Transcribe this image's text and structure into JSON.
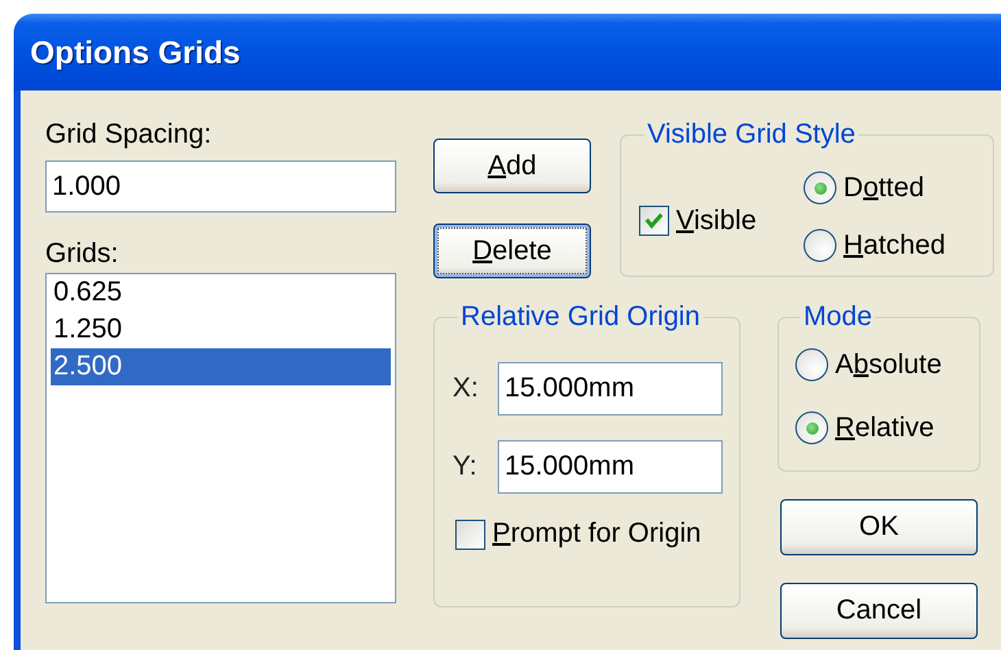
{
  "window": {
    "title": "Options Grids"
  },
  "grid_spacing": {
    "label": "Grid Spacing:",
    "value": "1.000"
  },
  "grids": {
    "label": "Grids:",
    "items": [
      {
        "text": "0.625",
        "selected": false
      },
      {
        "text": "1.250",
        "selected": false
      },
      {
        "text": "2.500",
        "selected": true
      }
    ]
  },
  "buttons": [
    {
      "label": [
        {
          "text": "A",
          "underlined": true
        },
        {
          "text": "dd",
          "underlined": false
        }
      ],
      "focused": false
    },
    {
      "label": [
        {
          "text": "D",
          "underlined": true
        },
        {
          "text": "elete",
          "underlined": false
        }
      ],
      "focused": true
    }
  ],
  "visible_grid_style": {
    "title": "Visible Grid Style",
    "visible": {
      "label": [
        {
          "text": "V",
          "underlined": true
        },
        {
          "text": "isible",
          "underlined": false
        }
      ],
      "checked": true
    },
    "styles": [
      {
        "label": [
          {
            "text": "D",
            "underlined": false
          },
          {
            "text": "o",
            "underlined": true
          },
          {
            "text": "tted",
            "underlined": false
          }
        ],
        "selected": true
      },
      {
        "label": [
          {
            "text": "H",
            "underlined": true
          },
          {
            "text": "atched",
            "underlined": false
          }
        ],
        "selected": false
      }
    ]
  },
  "relative_grid_origin": {
    "title": "Relative Grid Origin",
    "fields": [
      {
        "label": "X:",
        "value": "15.000mm"
      },
      {
        "label": "Y:",
        "value": "15.000mm"
      }
    ],
    "prompt": {
      "label": [
        {
          "text": "P",
          "underlined": true
        },
        {
          "text": "rompt for Origin",
          "underlined": false
        }
      ],
      "checked": false
    }
  },
  "mode": {
    "title": "Mode",
    "options": [
      {
        "label": [
          {
            "text": "A",
            "underlined": false
          },
          {
            "text": "b",
            "underlined": true
          },
          {
            "text": "solute",
            "underlined": false
          }
        ],
        "selected": false
      },
      {
        "label": [
          {
            "text": "R",
            "underlined": true
          },
          {
            "text": "elative",
            "underlined": false
          }
        ],
        "selected": true
      }
    ]
  },
  "dialog_buttons": [
    {
      "label": "OK"
    },
    {
      "label": "Cancel"
    }
  ]
}
